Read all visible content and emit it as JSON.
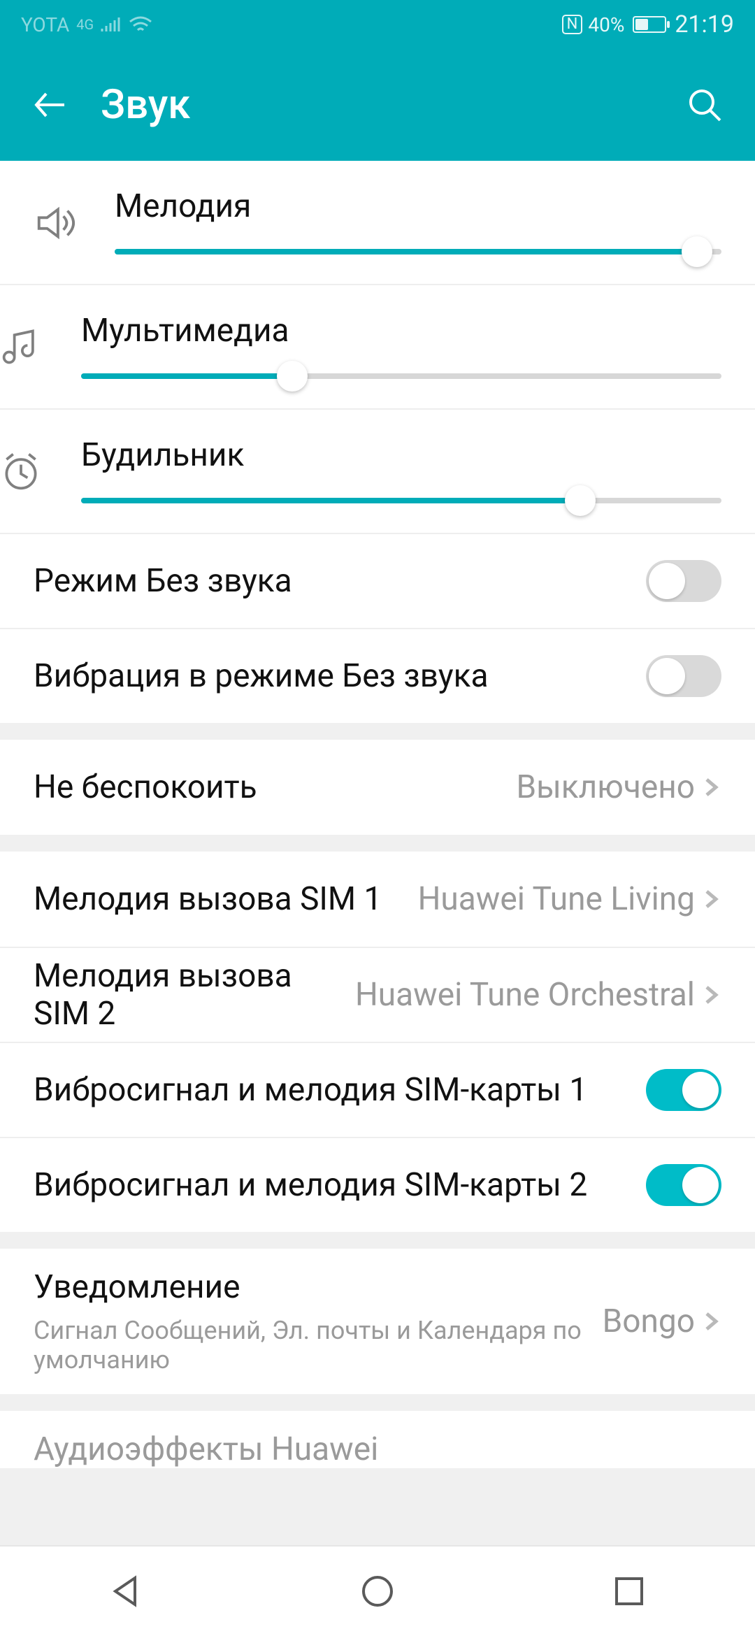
{
  "statusbar": {
    "carrier": "YOTA",
    "network_label": "4G",
    "nfc_label": "N",
    "battery_percent_text": "40%",
    "battery_level": 40,
    "time": "21:19"
  },
  "appbar": {
    "title": "Звук"
  },
  "sliders": {
    "ringtone": {
      "label": "Мелодия",
      "value": 96
    },
    "media": {
      "label": "Мультимедиа",
      "value": 33
    },
    "alarm": {
      "label": "Будильник",
      "value": 78
    }
  },
  "toggles": {
    "silent_mode": {
      "label": "Режим Без звука",
      "on": false
    },
    "vibrate_in_silent": {
      "label": "Вибрация в режиме Без звука",
      "on": false
    },
    "vibrate_sim1": {
      "label": "Вибросигнал и мелодия SIM-карты 1",
      "on": true
    },
    "vibrate_sim2": {
      "label": "Вибросигнал и мелодия SIM-карты 2",
      "on": true
    }
  },
  "links": {
    "dnd": {
      "label": "Не беспокоить",
      "value": "Выключено"
    },
    "ringtone_sim1": {
      "label": "Мелодия вызова SIM 1",
      "value": "Huawei Tune Living"
    },
    "ringtone_sim2": {
      "label": "Мелодия вызова SIM 2",
      "value": "Huawei Tune Orchestral"
    },
    "notification": {
      "label": "Уведомление",
      "sublabel": "Сигнал Сообщений, Эл. почты и Календаря по умолчанию",
      "value": "Bongo"
    },
    "huawei_audio": {
      "label": "Аудиоэффекты Huawei"
    }
  }
}
